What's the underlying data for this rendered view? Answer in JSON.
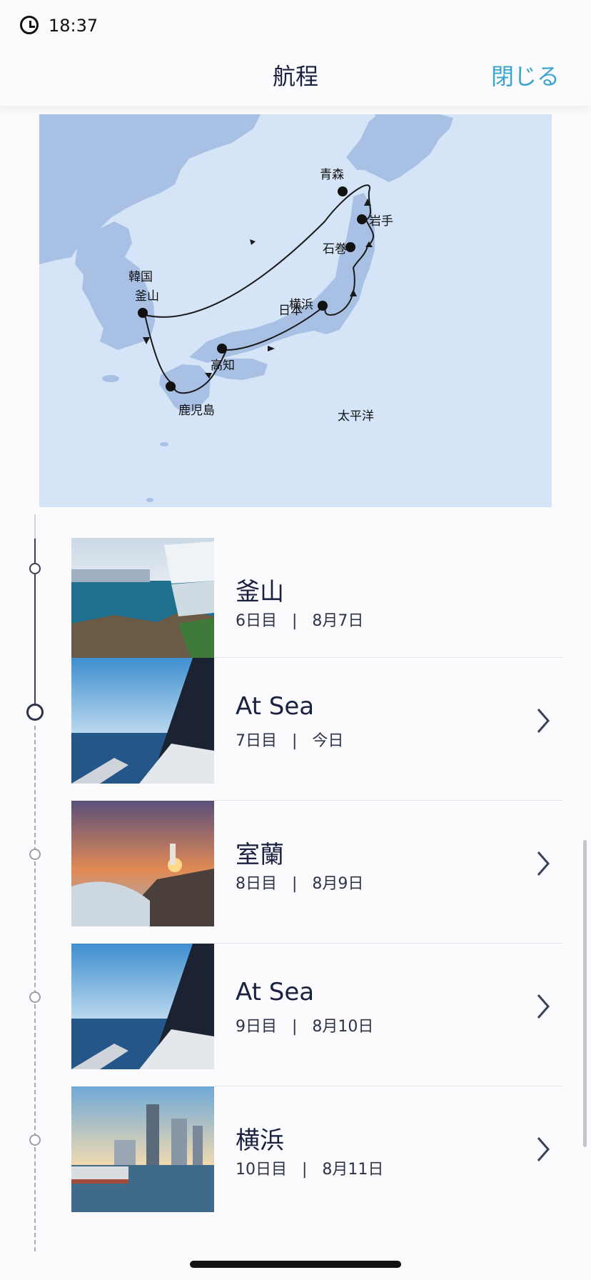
{
  "status_bar": {
    "time": "18:37"
  },
  "header": {
    "title": "航程",
    "close_label": "閉じる"
  },
  "map": {
    "labels": {
      "aomori": "青森",
      "iwate": "岩手",
      "ishinomaki": "石巻",
      "korea": "韓国",
      "busan": "釜山",
      "japan": "日本",
      "yokohama": "横浜",
      "kochi": "高知",
      "kagoshima": "鹿児島",
      "pacific": "太平洋"
    },
    "colors": {
      "sea": "#d5e4f6",
      "land": "#a7c0e4",
      "route": "#1a1a1a"
    }
  },
  "itinerary": [
    {
      "name": "釜山",
      "day": "6日目",
      "sep": "|",
      "date": "8月7日",
      "has_chevron": false
    },
    {
      "name": "At Sea",
      "day": "7日目",
      "sep": "|",
      "date": "今日",
      "has_chevron": true
    },
    {
      "name": "室蘭",
      "day": "8日目",
      "sep": "|",
      "date": "8月9日",
      "has_chevron": true
    },
    {
      "name": "At Sea",
      "day": "9日目",
      "sep": "|",
      "date": "8月10日",
      "has_chevron": true
    },
    {
      "name": "横浜",
      "day": "10日目",
      "sep": "|",
      "date": "8月11日",
      "has_chevron": true
    }
  ],
  "icons": {
    "status_clock": "clock-icon",
    "row_chevron": "chevron-right-icon"
  },
  "accent_color": "#3aa6cf"
}
